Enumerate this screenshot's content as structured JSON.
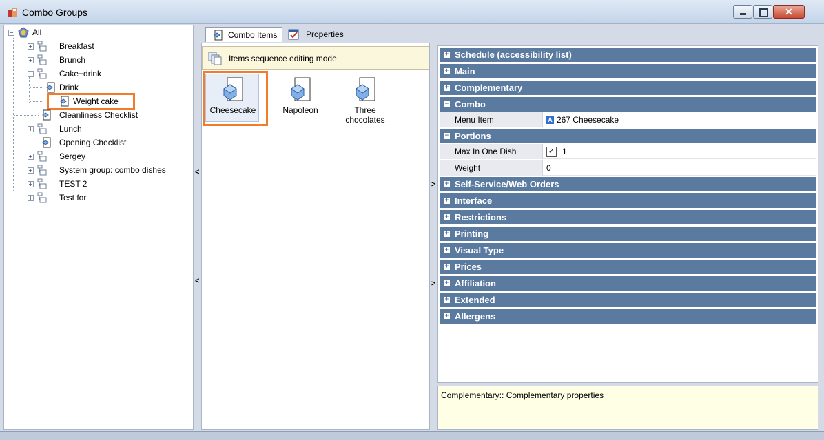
{
  "window": {
    "title": "Combo Groups",
    "close_glyph": "✕"
  },
  "tree": {
    "root": "All",
    "items": [
      {
        "label": "Breakfast",
        "icon": "folder-icon"
      },
      {
        "label": "Brunch",
        "icon": "folder-icon"
      },
      {
        "label": "Cake+drink",
        "icon": "folder-icon"
      },
      {
        "label": "Drink",
        "icon": "combo-icon"
      },
      {
        "label": "Weight cake",
        "icon": "combo-icon"
      },
      {
        "label": "Cleanliness Checklist",
        "icon": "combo-icon"
      },
      {
        "label": "Lunch",
        "icon": "folder-icon"
      },
      {
        "label": "Opening Checklist",
        "icon": "combo-icon"
      },
      {
        "label": "Sergey",
        "icon": "folder-icon"
      },
      {
        "label": "System group: combo dishes",
        "icon": "folder-icon"
      },
      {
        "label": "TEST 2",
        "icon": "folder-icon"
      },
      {
        "label": "Test for",
        "icon": "folder-icon"
      }
    ]
  },
  "tabs": [
    {
      "label": "Combo Items"
    },
    {
      "label": "Properties"
    }
  ],
  "sequence_banner": "Items sequence editing mode",
  "combo_items": [
    {
      "label": "Cheesecake"
    },
    {
      "label": "Napoleon"
    },
    {
      "label": "Three chocolates"
    }
  ],
  "properties": {
    "cat_schedule": "Schedule (accessibility list)",
    "cat_main": "Main",
    "cat_complementary": "Complementary",
    "cat_combo": "Combo",
    "menu_item_name": "Menu Item",
    "menu_item_value": "267 Cheesecake",
    "menu_item_icon_glyph": "A",
    "cat_portions": "Portions",
    "max_in_one_dish_name": "Max In One Dish",
    "max_in_one_dish_value": "1",
    "checkbox_glyph": "✓",
    "weight_name": "Weight",
    "weight_value": "0",
    "cat_self_service": "Self-Service/Web Orders",
    "cat_interface": "Interface",
    "cat_restrictions": "Restrictions",
    "cat_printing": "Printing",
    "cat_visual_type": "Visual Type",
    "cat_prices": "Prices",
    "cat_affiliation": "Affiliation",
    "cat_extended": "Extended",
    "cat_allergens": "Allergens",
    "expand_glyph": "+",
    "collapse_glyph": "−"
  },
  "description": "Complementary:: Complementary properties",
  "splitter_glyphs": {
    "left": "<",
    "right": ">"
  },
  "tree_glyphs": {
    "expand": "+",
    "collapse": "−"
  },
  "colors": {
    "category_bg": "#5a7aa0",
    "highlight": "#f07c2c",
    "banner_bg": "#fbf7dc",
    "description_bg": "#ffffe6"
  }
}
